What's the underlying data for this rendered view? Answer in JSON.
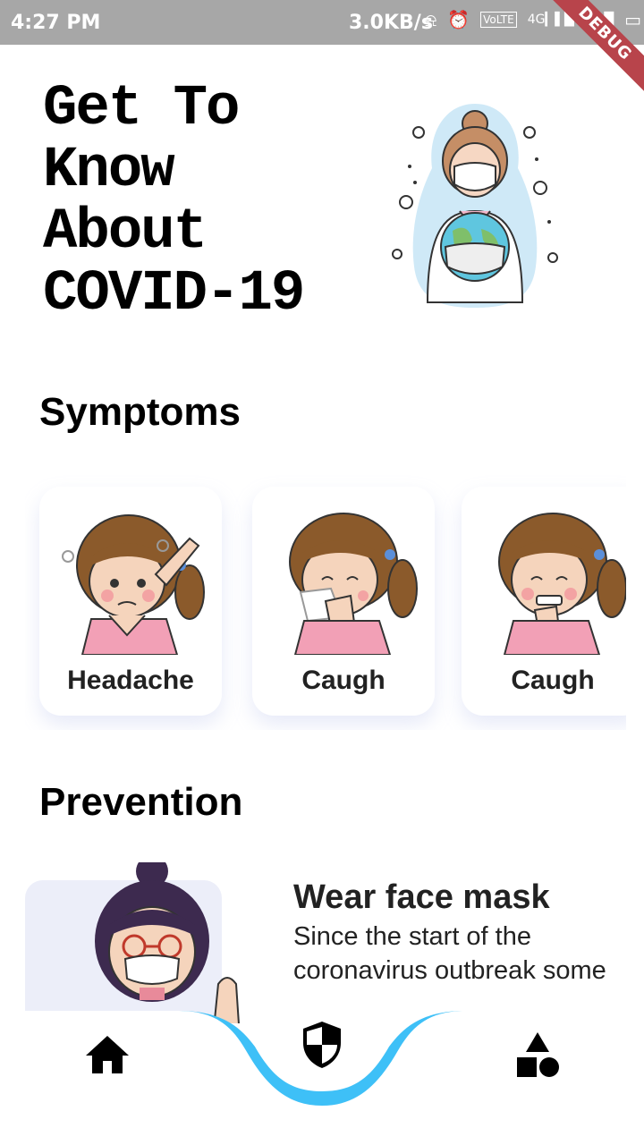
{
  "status_bar": {
    "time": "4:27 PM",
    "network_speed": "3.0KB/s",
    "icons": [
      "bell-off-icon",
      "alarm-icon",
      "volte-icon",
      "signal-4g-icon",
      "signal-icon",
      "battery-charging-icon"
    ],
    "debug_banner": "DEBUG"
  },
  "header": {
    "title_lines": [
      "Get To",
      "Know",
      "About",
      "COVID-19"
    ],
    "illustration": "doctor-holding-globe-with-mask"
  },
  "symptoms": {
    "title": "Symptoms",
    "items": [
      {
        "label": "Headache",
        "illustration": "girl-headache"
      },
      {
        "label": "Caugh",
        "illustration": "girl-sneezing"
      },
      {
        "label": "Caugh",
        "illustration": "girl-coughing"
      }
    ]
  },
  "prevention": {
    "title": "Prevention",
    "card": {
      "heading": "Wear face mask",
      "text": "Since the start of the coronavirus outbreak some",
      "illustration": "girl-wearing-mask-thumbs-up"
    }
  },
  "bottom_nav": {
    "items": [
      {
        "icon": "home-icon",
        "selected": false
      },
      {
        "icon": "shield-icon",
        "selected": true
      },
      {
        "icon": "shapes-icon",
        "selected": false
      }
    ],
    "accent_color": "#3ec0f7"
  },
  "colors": {
    "background": "#ffffff",
    "status_bar": "#a7a7a7",
    "debug_ribbon": "#b8444b",
    "text": "#222222",
    "nav_accent": "#3ec0f7"
  }
}
